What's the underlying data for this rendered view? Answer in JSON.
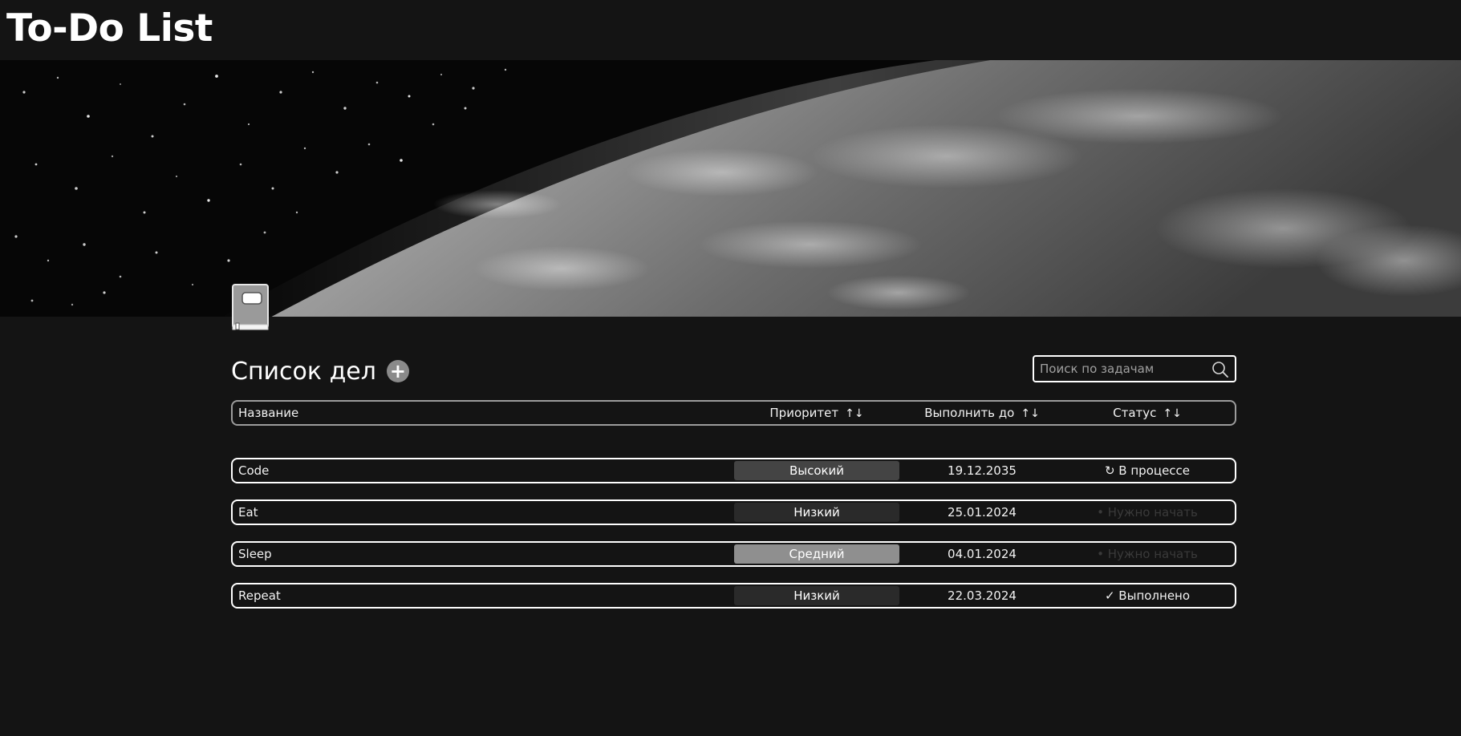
{
  "app": {
    "title": "To-Do List"
  },
  "list": {
    "title": "Список дел",
    "add_label": "+"
  },
  "search": {
    "placeholder": "Поиск по задачам",
    "value": ""
  },
  "columns": {
    "name": "Название",
    "priority": "Приоритет",
    "due": "Выполнить до",
    "status": "Статус",
    "sort_glyph": "↑↓"
  },
  "tasks": [
    {
      "name": "Code",
      "priority": "Высокий",
      "priority_color": "#444444",
      "due": "19.12.2035",
      "status": "↻ В процессе",
      "status_color": "#f2f2f2"
    },
    {
      "name": "Eat",
      "priority": "Низкий",
      "priority_color": "#2a2a2a",
      "due": "25.01.2024",
      "status": "• Нужно начать",
      "status_color": "#3a3a3a"
    },
    {
      "name": "Sleep",
      "priority": "Средний",
      "priority_color": "#8f8f8f",
      "due": "04.01.2024",
      "status": "• Нужно начать",
      "status_color": "#3a3a3a"
    },
    {
      "name": "Repeat",
      "priority": "Низкий",
      "priority_color": "#2a2a2a",
      "due": "22.03.2024",
      "status": "✓ Выполнено",
      "status_color": "#f2f2f2"
    }
  ],
  "icons": {
    "search": "search-icon",
    "notebook": "notebook-icon",
    "add": "plus-icon",
    "sort": "sort-arrows-icon"
  }
}
